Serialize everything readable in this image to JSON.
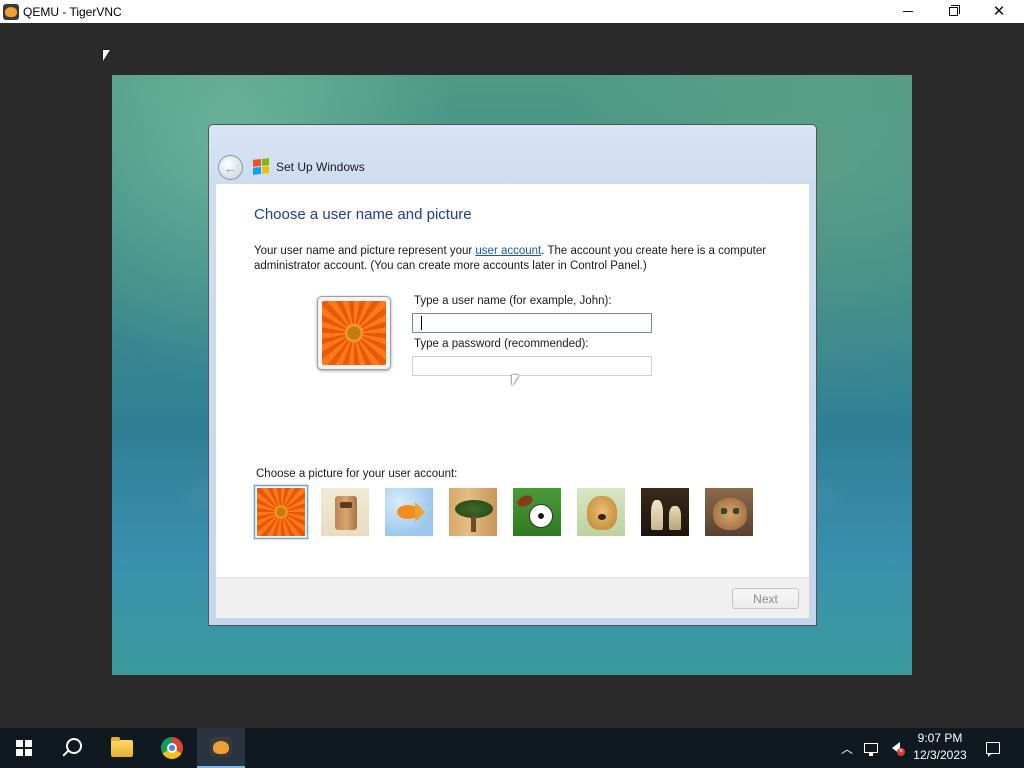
{
  "host_window": {
    "title": "QEMU - TigerVNC",
    "app_icon": "tigervnc-icon",
    "controls": {
      "minimize": "minimize-icon",
      "maximize": "restore-icon",
      "close": "close-icon"
    }
  },
  "setup_dialog": {
    "window_title": "Set Up Windows",
    "back_icon": "back-arrow-icon",
    "heading": "Choose a user name and picture",
    "description_before_link": "Your user name and picture represent your ",
    "description_link": "user account",
    "description_after_link": ". The account you create here is a computer administrator account. (You can create more accounts later in Control Panel.)",
    "username_label": "Type a user name (for example, John):",
    "username_value": "",
    "password_label": "Type a password (recommended):",
    "password_value": "",
    "picture_label": "Choose a picture for your user account:",
    "pictures": [
      "flower",
      "robot",
      "fish",
      "bonsai",
      "sports-balls",
      "dog",
      "chess",
      "cat"
    ],
    "selected_picture": "flower",
    "next_label": "Next",
    "next_enabled": false
  },
  "taskbar": {
    "pinned": [
      "start",
      "search",
      "file-explorer",
      "chrome",
      "tigervnc"
    ],
    "active": "tigervnc",
    "tray": {
      "time": "9:07 PM",
      "date": "12/3/2023",
      "volume_muted": true
    }
  },
  "colors": {
    "heading_blue": "#1e3f8a",
    "link_blue": "#1a5aa8",
    "taskbar_bg": "#101820",
    "host_bg": "#2b2b2b"
  }
}
